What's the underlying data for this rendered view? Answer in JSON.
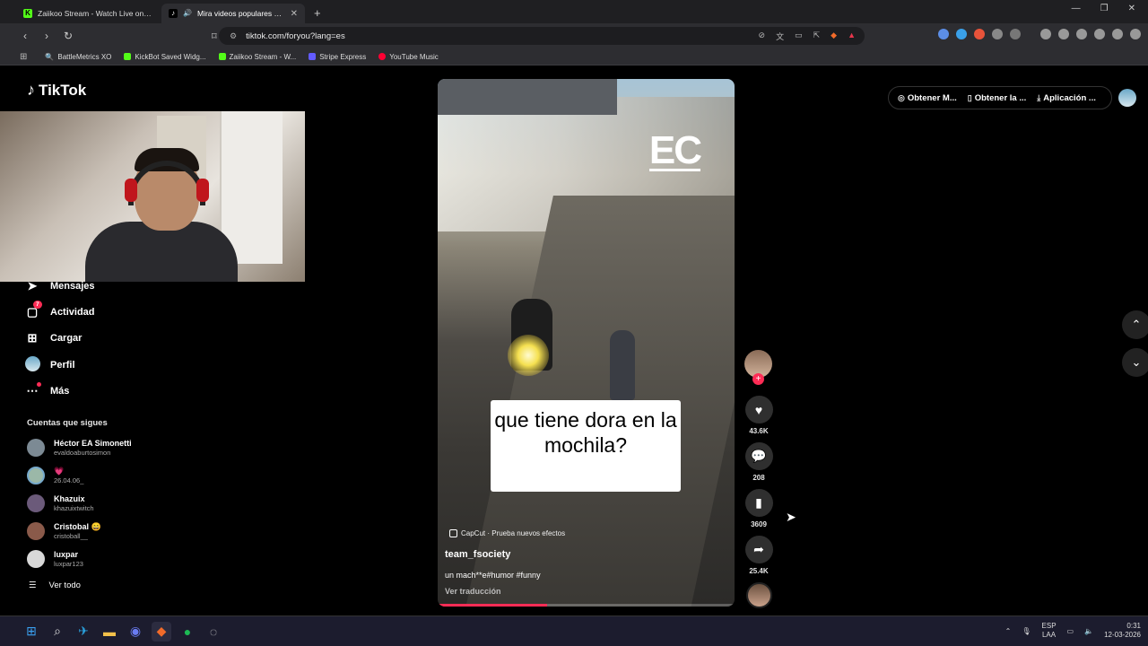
{
  "browser": {
    "tabs": [
      {
        "title": "Zaiikoo Stream - Watch Live on Kick",
        "active": false
      },
      {
        "title": "Mira videos populares selecc",
        "active": true
      }
    ],
    "url": "tiktok.com/foryou?lang=es",
    "bookmarks": [
      "BattleMetrics XO",
      "KickBot Saved Widg...",
      "Zaiikoo Stream - W...",
      "Stripe Express",
      "YouTube Music"
    ]
  },
  "tiktok": {
    "logo": "TikTok",
    "nav": [
      {
        "label": "Mensajes",
        "icon": "send-icon"
      },
      {
        "label": "Actividad",
        "icon": "inbox-icon",
        "badge": "7"
      },
      {
        "label": "Cargar",
        "icon": "upload-icon"
      },
      {
        "label": "Perfil",
        "icon": "avatar"
      },
      {
        "label": "Más",
        "icon": "more-icon"
      }
    ],
    "following_title": "Cuentas que sigues",
    "following": [
      {
        "name": "Héctor EA Simonetti",
        "handle": "evaldoaburtosimon",
        "color": "#7c8a94"
      },
      {
        "name": "💗",
        "handle": "26.04.06_",
        "color": "#9bb8a8"
      },
      {
        "name": "Khazuix",
        "handle": "khazuixtwitch",
        "color": "#6b5a7a"
      },
      {
        "name": "Cristobal 😄",
        "handle": "cristoball__",
        "color": "#8a5a4a"
      },
      {
        "name": "luxpar",
        "handle": "luxpar123",
        "color": "#d8d8d8"
      }
    ],
    "see_all": "Ver todo",
    "top_actions": [
      "Obtener M...",
      "Obtener la ...",
      "Aplicación ..."
    ]
  },
  "video": {
    "watermark": "EC",
    "caption": "que tiene dora en la mochila?",
    "capcut": "CapCut · Prueba nuevos efectos",
    "author": "team_fsociety",
    "description": "un mach**e#humor #funny",
    "translate": "Ver traducción",
    "progress": 0.37,
    "likes": "43.6K",
    "comments": "208",
    "saves": "3609",
    "shares": "25.4K"
  },
  "taskbar": {
    "lang_top": "ESP",
    "lang_bottom": "LAA",
    "time": "0:31",
    "date": "12-03-2026"
  }
}
